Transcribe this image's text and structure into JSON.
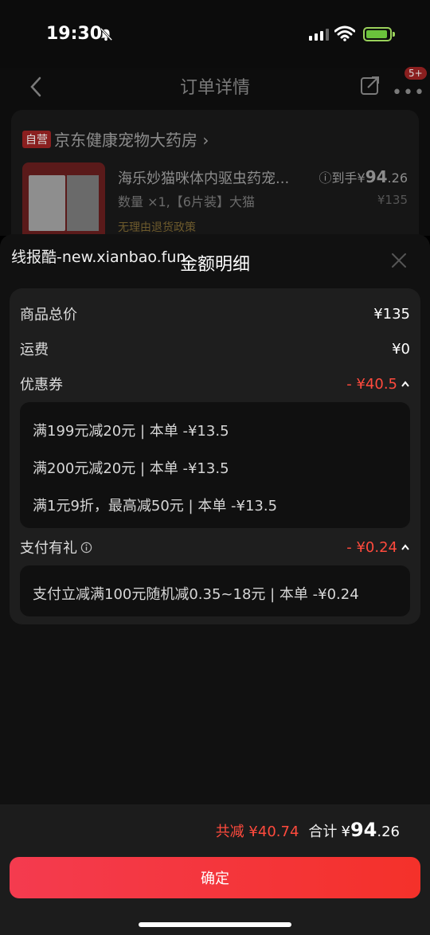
{
  "status": {
    "time": "19:30"
  },
  "background_page": {
    "nav_title": "订单详情",
    "more_badge": "5+",
    "self_tag": "自营",
    "store_name": "京东健康宠物大药房 ›",
    "product_name": "海乐妙猫咪体内驱虫药宠...",
    "product_qty": "数量 ×1,【6片装】大猫",
    "policy": "无理由退货政策",
    "price_prefix": "ⓘ到手",
    "price_currency": "¥",
    "price_int": "94",
    "price_dec": ".26",
    "original_price": "¥135"
  },
  "sheet": {
    "watermark": "线报酷-new.xianbao.fun",
    "title": "金额明细",
    "rows": {
      "goods_total": {
        "label": "商品总价",
        "value": "¥135"
      },
      "shipping": {
        "label": "运费",
        "value": "¥0"
      },
      "coupon": {
        "label": "优惠券",
        "value": "- ¥40.5"
      },
      "pay_gift": {
        "label": "支付有礼",
        "value": "- ¥0.24"
      }
    },
    "coupon_items": [
      "满199元减20元 | 本单 -¥13.5",
      "满200元减20元 | 本单 -¥13.5",
      "满1元9折，最高减50元 | 本单 -¥13.5"
    ],
    "pay_gift_items": [
      "支付立减满100元随机减0.35~18元 | 本单 -¥0.24"
    ]
  },
  "footer": {
    "saved": "共减 ¥40.74",
    "total_label": "合计",
    "total_currency": "¥",
    "total_int": "94",
    "total_dec": ".26",
    "confirm": "确定"
  },
  "colors": {
    "accent_red": "#ff4a3d",
    "button_gradient_start": "#f43b4f",
    "button_gradient_end": "#f4312a"
  }
}
